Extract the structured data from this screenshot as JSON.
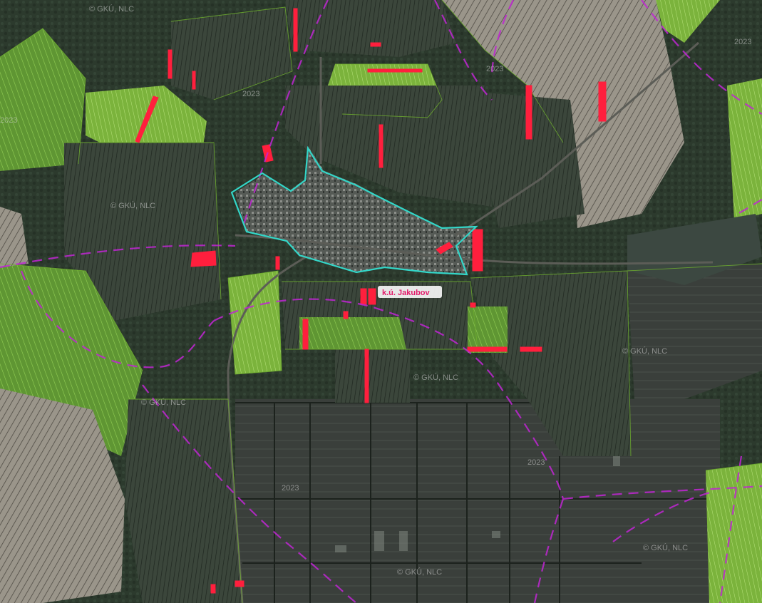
{
  "map": {
    "cadastral_area_label": "k.ú. Jakubov",
    "copyright_label": "© GKÚ, NLC",
    "imagery_year_label": "2023"
  },
  "colors": {
    "boundary_violet": "#c026d3",
    "highlight_red": "#ff1f3d",
    "intravilan_cyan": "#33d6c8",
    "label_pink": "#e21b6a",
    "parcel_green": "#6fae2f",
    "forest_dark": "#2a3a2c"
  }
}
